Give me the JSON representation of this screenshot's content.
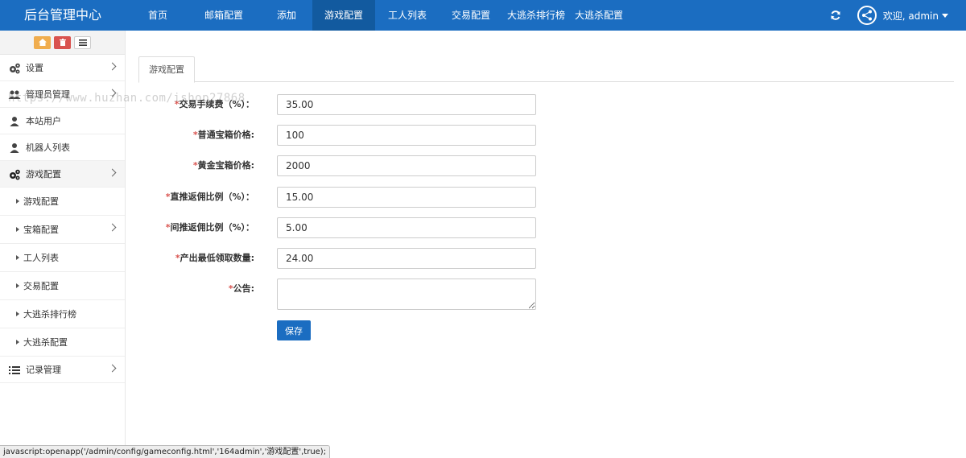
{
  "app": {
    "brand": "后台管理中心"
  },
  "nav": {
    "items": [
      {
        "label": "首页"
      },
      {
        "label": "邮箱配置"
      },
      {
        "label": "添加"
      },
      {
        "label": "游戏配置"
      },
      {
        "label": "工人列表"
      },
      {
        "label": "交易配置"
      },
      {
        "label": "大逃杀排行榜"
      },
      {
        "label": "大逃杀配置"
      }
    ],
    "active": "游戏配置",
    "welcome": "欢迎, admin"
  },
  "sidebar": {
    "items": [
      {
        "label": "设置",
        "icon": "gears-icon"
      },
      {
        "label": "管理员管理",
        "icon": "users-icon"
      },
      {
        "label": "本站用户",
        "icon": "user-icon"
      },
      {
        "label": "机器人列表",
        "icon": "user-icon"
      },
      {
        "label": "游戏配置",
        "icon": "gears-icon"
      },
      {
        "label": "游戏配置"
      },
      {
        "label": "宝箱配置"
      },
      {
        "label": "工人列表"
      },
      {
        "label": "交易配置"
      },
      {
        "label": "大逃杀排行榜"
      },
      {
        "label": "大逃杀配置"
      },
      {
        "label": "记录管理",
        "icon": "list-icon"
      }
    ]
  },
  "main": {
    "tab": "游戏配置",
    "fields": [
      {
        "label": "交易手续费（%）：",
        "value": "35.00"
      },
      {
        "label": "普通宝箱价格:",
        "value": "100"
      },
      {
        "label": "黄金宝箱价格:",
        "value": "2000"
      },
      {
        "label": "直推返佣比例（%）：",
        "value": "15.00"
      },
      {
        "label": "间推返佣比例（%）：",
        "value": "5.00"
      },
      {
        "label": "产出最低领取数量:",
        "value": "24.00"
      },
      {
        "label": "公告:",
        "value": ""
      }
    ],
    "required_mark": "*",
    "save_label": "保存"
  },
  "watermark": "https://www.huzhan.com/ishop27868",
  "statusbar": "javascript:openapp('/admin/config/gameconfig.html','164admin','游戏配置',true);",
  "colors": {
    "primary": "#1b6dc1",
    "nav_active": "#125a9f",
    "required": "#d9534f"
  }
}
